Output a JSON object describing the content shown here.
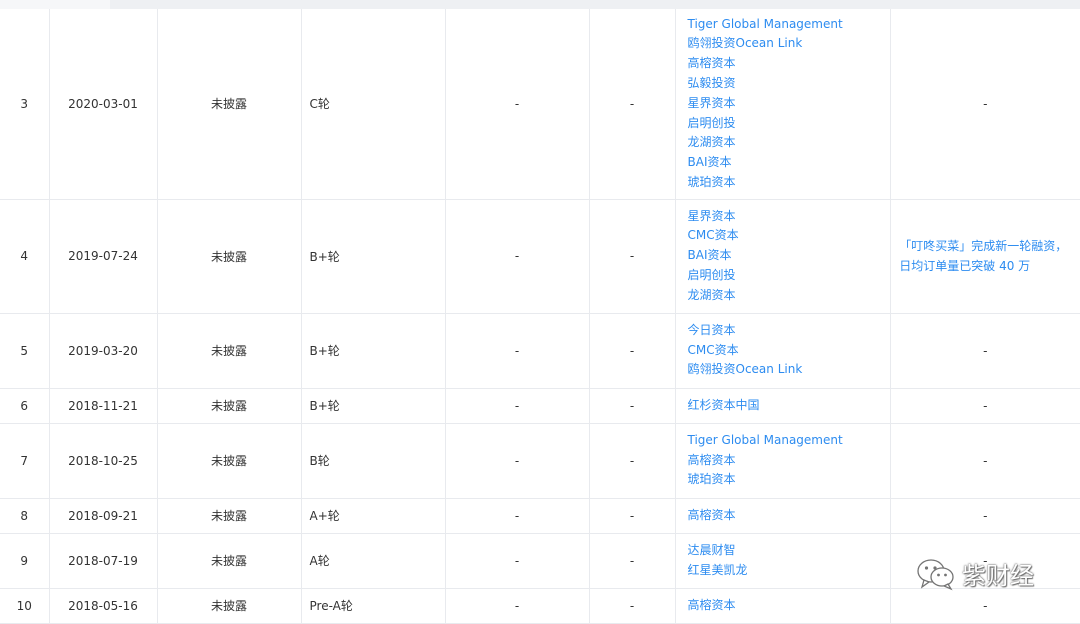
{
  "colors": {
    "link": "#2d8cf0",
    "text": "#333333",
    "border": "#e8eaee"
  },
  "rows": [
    {
      "index": "3",
      "date": "2020-03-01",
      "amount": "未披露",
      "round": "C轮",
      "valuation": "-",
      "ratio": "-",
      "investors": [
        "Tiger Global Management",
        "鸥翎投资Ocean Link",
        "高榕资本",
        "弘毅投资",
        "星界资本",
        "启明创投",
        "龙湖资本",
        "BAI资本",
        "琥珀资本"
      ],
      "news": "-"
    },
    {
      "index": "4",
      "date": "2019-07-24",
      "amount": "未披露",
      "round": "B+轮",
      "valuation": "-",
      "ratio": "-",
      "investors": [
        "星界资本",
        "CMC资本",
        "BAI资本",
        "启明创投",
        "龙湖资本"
      ],
      "news": "「叮咚买菜」完成新一轮融资，日均订单量已突破 40 万"
    },
    {
      "index": "5",
      "date": "2019-03-20",
      "amount": "未披露",
      "round": "B+轮",
      "valuation": "-",
      "ratio": "-",
      "investors": [
        "今日资本",
        "CMC资本",
        "鸥翎投资Ocean Link"
      ],
      "news": "-"
    },
    {
      "index": "6",
      "date": "2018-11-21",
      "amount": "未披露",
      "round": "B+轮",
      "valuation": "-",
      "ratio": "-",
      "investors": [
        "红杉资本中国"
      ],
      "news": "-"
    },
    {
      "index": "7",
      "date": "2018-10-25",
      "amount": "未披露",
      "round": "B轮",
      "valuation": "-",
      "ratio": "-",
      "investors": [
        "Tiger Global Management",
        "高榕资本",
        "琥珀资本"
      ],
      "news": "-"
    },
    {
      "index": "8",
      "date": "2018-09-21",
      "amount": "未披露",
      "round": "A+轮",
      "valuation": "-",
      "ratio": "-",
      "investors": [
        "高榕资本"
      ],
      "news": "-"
    },
    {
      "index": "9",
      "date": "2018-07-19",
      "amount": "未披露",
      "round": "A轮",
      "valuation": "-",
      "ratio": "-",
      "investors": [
        "达晨财智",
        "红星美凯龙"
      ],
      "news": "-"
    },
    {
      "index": "10",
      "date": "2018-05-16",
      "amount": "未披露",
      "round": "Pre-A轮",
      "valuation": "-",
      "ratio": "-",
      "investors": [
        "高榕资本"
      ],
      "news": "-"
    }
  ],
  "watermark": {
    "icon": "wechat-icon",
    "text": "紫财经"
  }
}
